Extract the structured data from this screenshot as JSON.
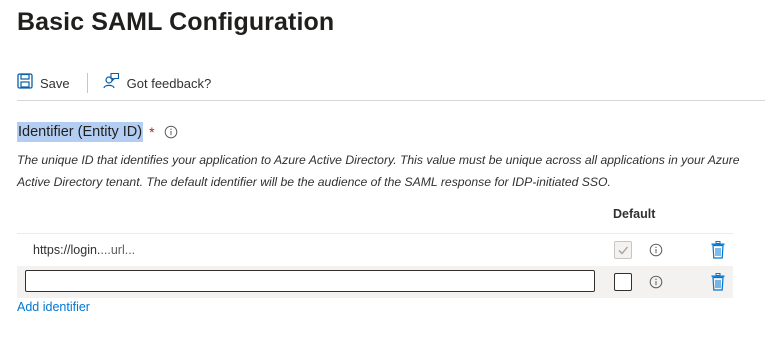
{
  "page": {
    "title": "Basic SAML Configuration"
  },
  "toolbar": {
    "save_label": "Save",
    "feedback_label": "Got feedback?"
  },
  "identifier": {
    "label": "Identifier (Entity ID)",
    "required_mark": "*",
    "description": "The unique ID that identifies your application to Azure Active Directory. This value must be unique across all applications in your Azure Active Directory tenant. The default identifier will be the audience of the SAML response for IDP-initiated SSO.",
    "column_default": "Default",
    "rows": [
      {
        "value_prefix": "https://login.",
        "value_masked": "...url...",
        "default_checked": true,
        "default_disabled": true
      }
    ],
    "new_row": {
      "value": "",
      "placeholder": ""
    },
    "add_label": "Add identifier"
  },
  "colors": {
    "accent": "#0078d4",
    "required": "#a4262c",
    "highlight": "#b4cdf3"
  },
  "icons": [
    "save-icon",
    "feedback-icon",
    "info-icon",
    "checkmark-icon",
    "trash-icon"
  ]
}
